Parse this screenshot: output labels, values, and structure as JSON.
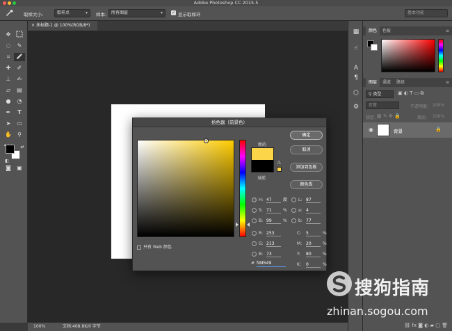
{
  "app": {
    "title": "Adobe Photoshop CC 2015.5"
  },
  "options": {
    "sample_size_label": "取样大小:",
    "sample_size_value": "取样点",
    "sample_label": "样本:",
    "sample_value": "所有图层",
    "show_ring_label": "显示取样环",
    "search_placeholder": "基本功能"
  },
  "document": {
    "tab_label": "未标题-1 @ 100%(RGB/8*)",
    "close": "×"
  },
  "status": {
    "zoom": "100%",
    "doc_info": "文档:468.8K/0 字节"
  },
  "color_panel": {
    "tabs": [
      "颜色",
      "色板"
    ]
  },
  "layers_panel": {
    "tabs": [
      "图层",
      "通道",
      "路径"
    ],
    "filter_label": "类型",
    "blend_mode": "正常",
    "opacity_label": "不透明度:",
    "opacity_value": "100%",
    "lock_label": "锁定:",
    "fill_label": "填充:",
    "fill_value": "100%",
    "layer_name": "背景"
  },
  "picker": {
    "title": "拾色器（前景色）",
    "new_label": "新的",
    "current_label": "当前",
    "ok": "确定",
    "cancel": "取消",
    "add_swatch": "添加到色板",
    "libraries": "颜色库",
    "hsb": [
      {
        "label": "H:",
        "value": "47",
        "unit": "度"
      },
      {
        "label": "S:",
        "value": "71",
        "unit": "%"
      },
      {
        "label": "B:",
        "value": "99",
        "unit": "%"
      }
    ],
    "rgb": [
      {
        "label": "R:",
        "value": "253"
      },
      {
        "label": "G:",
        "value": "213"
      },
      {
        "label": "B:",
        "value": "73"
      }
    ],
    "lab": [
      {
        "label": "L:",
        "value": "87"
      },
      {
        "label": "a:",
        "value": "4"
      },
      {
        "label": "b:",
        "value": "77"
      }
    ],
    "cmyk": [
      {
        "label": "C:",
        "value": "5",
        "unit": "%"
      },
      {
        "label": "M:",
        "value": "20",
        "unit": "%"
      },
      {
        "label": "Y:",
        "value": "80",
        "unit": "%"
      },
      {
        "label": "K:",
        "value": "0",
        "unit": "%"
      }
    ],
    "hex_label": "#",
    "hex_value": "fdd549",
    "web_only": "只有 Web 颜色",
    "hue_level": 0.87,
    "saturation": 0.71,
    "brightness": 0.99
  },
  "colors": {
    "new": "#fdd549",
    "current": "#000000",
    "foreground": "#000000",
    "background": "#ffffff"
  },
  "icons": [
    "move-icon",
    "marquee-icon",
    "lasso-icon",
    "quick-select-icon",
    "crop-icon",
    "eyedropper-icon",
    "healing-icon",
    "brush-icon",
    "stamp-icon",
    "history-brush-icon",
    "eraser-icon",
    "gradient-icon",
    "blur-icon",
    "dodge-icon",
    "pen-icon",
    "type-icon",
    "path-select-icon",
    "rectangle-icon",
    "hand-icon",
    "zoom-icon"
  ],
  "watermark": {
    "text": "搜狗指南",
    "url": "zhinan.sogou.com"
  }
}
